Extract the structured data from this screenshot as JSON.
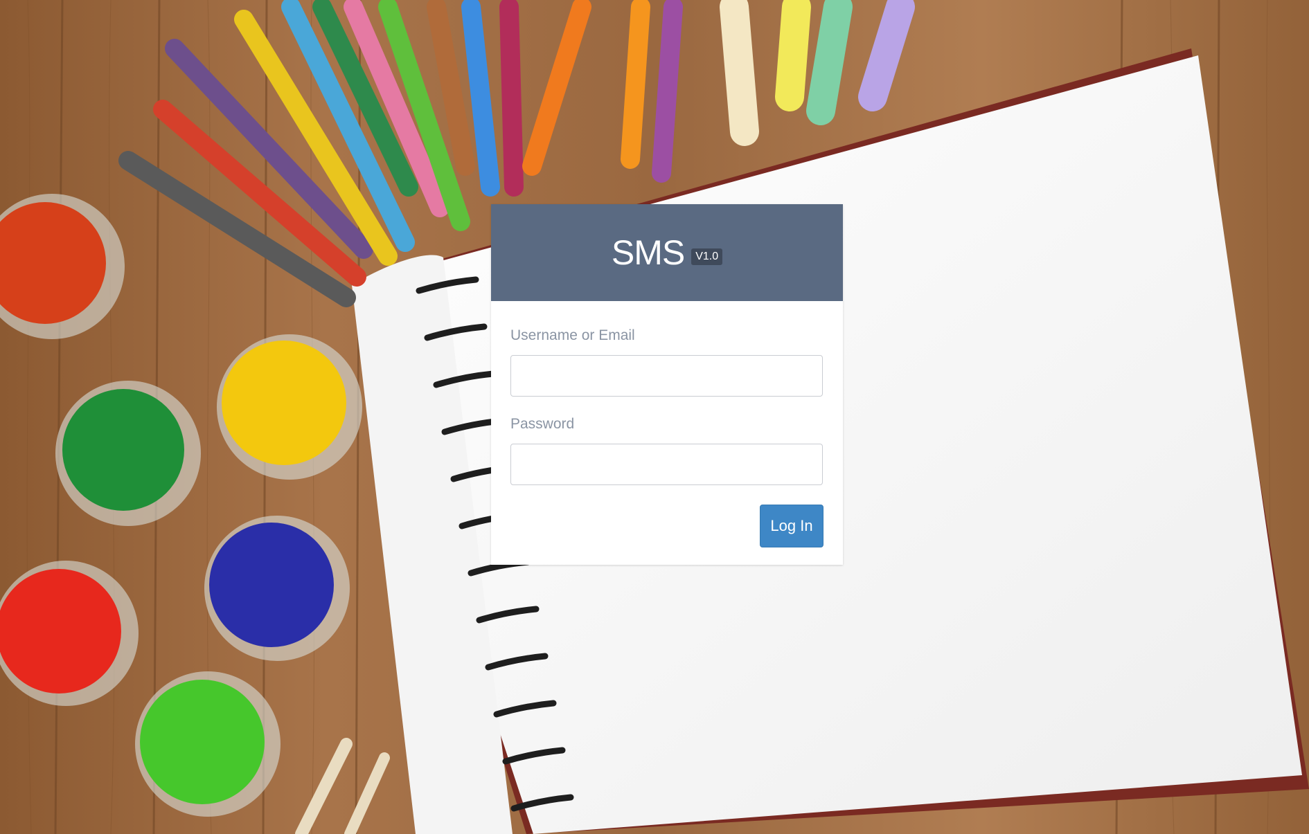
{
  "app": {
    "title": "SMS",
    "version": "V1.0"
  },
  "form": {
    "username_label": "Username or Email",
    "username_value": "",
    "password_label": "Password",
    "password_value": "",
    "submit_label": "Log In"
  },
  "colors": {
    "header_bg": "#5a6a82",
    "button_bg": "#3e87c6",
    "label_text": "#8a94a3"
  }
}
